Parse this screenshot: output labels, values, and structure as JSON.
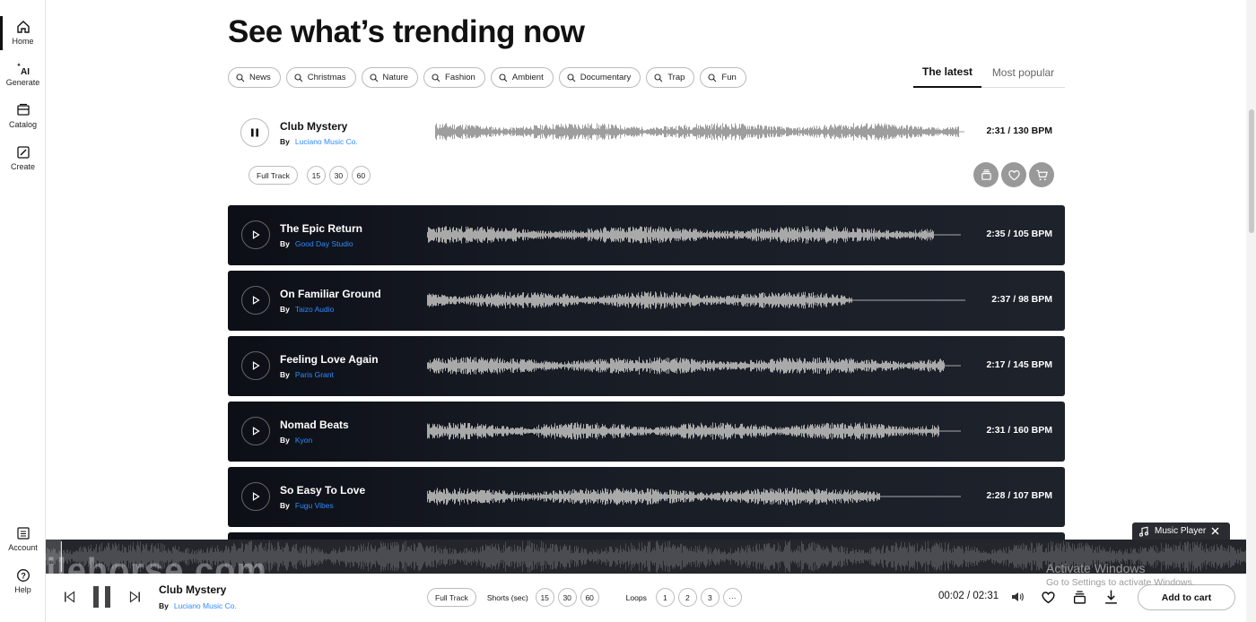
{
  "sidebar": {
    "items": [
      {
        "label": "Home",
        "icon": "home-icon"
      },
      {
        "label": "Generate",
        "icon": "ai-sparkle-icon"
      },
      {
        "label": "Catalog",
        "icon": "catalog-icon"
      },
      {
        "label": "Create",
        "icon": "create-icon"
      },
      {
        "label": "Account",
        "icon": "account-icon"
      },
      {
        "label": "Help",
        "icon": "help-icon"
      }
    ]
  },
  "page": {
    "title": "See what’s trending now",
    "chips": [
      "News",
      "Christmas",
      "Nature",
      "Fashion",
      "Ambient",
      "Documentary",
      "Trap",
      "Fun"
    ],
    "tabs": {
      "latest": "The latest",
      "popular": "Most popular"
    }
  },
  "by_label": "By",
  "active_track": {
    "title": "Club Mystery",
    "artist": "Luciano Music Co.",
    "meta": "2:31 / 130 BPM",
    "full_track": "Full Track",
    "shorts": [
      "15",
      "30",
      "60"
    ]
  },
  "tracks": [
    {
      "title": "The Epic Return",
      "artist": "Good Day Studio",
      "meta": "2:35 / 105 BPM"
    },
    {
      "title": "On Familiar Ground",
      "artist": "Taizo Audio",
      "meta": "2:37 / 98 BPM"
    },
    {
      "title": "Feeling Love Again",
      "artist": "Paris Grant",
      "meta": "2:17 / 145 BPM"
    },
    {
      "title": "Nomad Beats",
      "artist": "Kyon",
      "meta": "2:31 / 160 BPM"
    },
    {
      "title": "So Easy To Love",
      "artist": "Fugu Vibes",
      "meta": "2:28 / 107 BPM"
    }
  ],
  "player": {
    "tab_label": "Music Player",
    "title": "Club Mystery",
    "artist": "Luciano Music Co.",
    "full_track": "Full Track",
    "shorts_label": "Shorts (sec)",
    "shorts": [
      "15",
      "30",
      "60"
    ],
    "loops_label": "Loops",
    "loops": [
      "1",
      "2",
      "3",
      "···"
    ],
    "time": "00:02 / 02:31",
    "add_to_cart": "Add to cart",
    "progress": 0.013
  },
  "overlay": {
    "watermark": "filehorse.com",
    "activate_title": "Activate Windows",
    "activate_sub": "Go to Settings to activate Windows."
  },
  "colors": {
    "link": "#2e8bff",
    "row_bg": "#181c25",
    "wave": "#a9a9a9",
    "player_bg": "#25262b"
  }
}
